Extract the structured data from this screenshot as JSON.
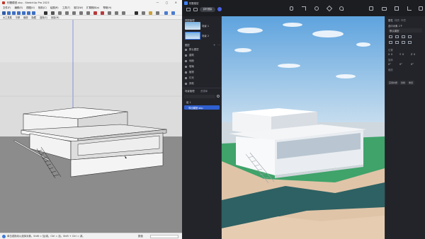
{
  "sketchup": {
    "title": "别墅模型.skp - SketchUp Pro 2023",
    "window_controls": "— ▢ ✕",
    "menu": [
      "文件(F)",
      "编辑(E)",
      "视图(V)",
      "相机(C)",
      "绘图(R)",
      "工具(T)",
      "窗口(W)",
      "扩展程序(x)",
      "帮助(H)"
    ],
    "toolbar2": [
      "大工具集",
      "平移",
      "缩放",
      "隐藏",
      "选择(S)",
      "测量(M)"
    ],
    "status_text": "单击或拖动以选择对象。Shift = 加/减。Ctrl = 加。Shift + Ctrl = 减。",
    "measure_label": "数值"
  },
  "enscape": {
    "title": "别墅模型",
    "mode_label": "实时渲染",
    "left_panel": {
      "views_header": "视图管理",
      "views": [
        "场景 1",
        "场景 2"
      ],
      "layers_header": "图层",
      "layers": [
        "默认图层",
        "建筑",
        "地面",
        "玻璃",
        "植物",
        "灯光",
        "其他"
      ],
      "scene_header": "场景管理",
      "scene_tab2": "资源库",
      "tree": [
        "组 1",
        "导出模型.skp"
      ]
    },
    "right_panel": {
      "tabs": [
        "属性",
        "材质",
        "环境"
      ],
      "object_label": "选中对象 1个",
      "name_value": "默认模型",
      "sections": [
        "位置",
        "旋转",
        "缩放"
      ],
      "axes": [
        "X",
        "Y",
        "Z"
      ],
      "values": [
        "0",
        "0",
        "0"
      ],
      "rot": [
        "0°",
        "0°",
        "0°"
      ],
      "buttons": [
        "应用材质",
        "替换",
        "重置"
      ]
    }
  },
  "colors": {
    "sketchup_bg": "#e9e9e9",
    "ground": "#8e8e8e",
    "sky_top": "#5ea3de",
    "grass": "#3fa36a",
    "accent": "#3e82f7"
  }
}
